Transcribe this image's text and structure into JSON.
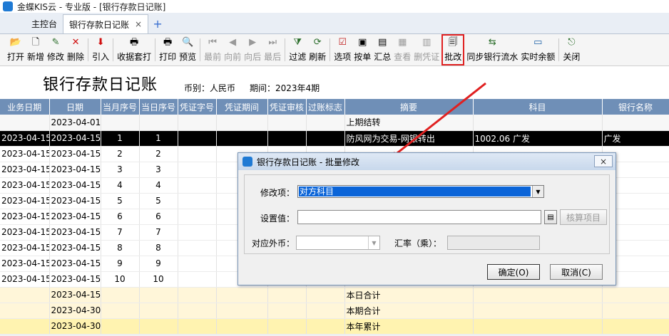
{
  "app": {
    "title": "金蝶KIS云 - 专业版 - [银行存款日记账]"
  },
  "tabs": [
    {
      "label": "主控台"
    },
    {
      "label": "银行存款日记账",
      "close": "×"
    }
  ],
  "tab_add": "+",
  "toolbar": {
    "open": "打开",
    "new": "新增",
    "edit": "修改",
    "delete": "删除",
    "import": "引入",
    "receipt_print": "收据套打",
    "print": "打印",
    "preview": "预览",
    "first": "最前",
    "prev": "向前",
    "next": "向后",
    "last": "最后",
    "filter": "过滤",
    "refresh": "刷新",
    "options": "选项",
    "by_voucher": "按单",
    "summary": "汇总",
    "view": "查看",
    "del_voucher": "删凭证",
    "batch_edit": "批改",
    "sync_bank": "同步银行流水",
    "realtime_balance": "实时余额",
    "close": "关闭"
  },
  "report": {
    "title": "银行存款日记账",
    "currency": "币别：人民币",
    "period": "期间：2023年4期"
  },
  "table": {
    "headers": [
      "业务日期",
      "日期",
      "当月序号",
      "当日序号",
      "凭证字号",
      "凭证期间",
      "凭证审核",
      "过账标志",
      "摘要",
      "科目",
      "银行名称"
    ],
    "rows": [
      {
        "biz": "",
        "date": "2023-04-01",
        "m": "",
        "d": "",
        "summary": "上期结转",
        "account": "",
        "bank": "",
        "kind": "carry"
      },
      {
        "biz": "2023-04-15",
        "date": "2023-04-15",
        "m": "1",
        "d": "1",
        "summary": "防风网为交易-网银转出",
        "account": "1002.06 广发",
        "bank": "广发",
        "kind": "selected"
      },
      {
        "biz": "2023-04-15",
        "date": "2023-04-15",
        "m": "2",
        "d": "2",
        "summary": "",
        "account": "",
        "bank": "",
        "kind": "normal"
      },
      {
        "biz": "2023-04-15",
        "date": "2023-04-15",
        "m": "3",
        "d": "3",
        "summary": "",
        "account": "",
        "bank": "",
        "kind": "normal"
      },
      {
        "biz": "2023-04-15",
        "date": "2023-04-15",
        "m": "4",
        "d": "4",
        "summary": "",
        "account": "",
        "bank": "",
        "kind": "normal"
      },
      {
        "biz": "2023-04-15",
        "date": "2023-04-15",
        "m": "5",
        "d": "5",
        "summary": "",
        "account": "",
        "bank": "",
        "kind": "normal"
      },
      {
        "biz": "2023-04-15",
        "date": "2023-04-15",
        "m": "6",
        "d": "6",
        "summary": "",
        "account": "",
        "bank": "",
        "kind": "normal"
      },
      {
        "biz": "2023-04-15",
        "date": "2023-04-15",
        "m": "7",
        "d": "7",
        "summary": "",
        "account": "",
        "bank": "",
        "kind": "normal"
      },
      {
        "biz": "2023-04-15",
        "date": "2023-04-15",
        "m": "8",
        "d": "8",
        "summary": "",
        "account": "",
        "bank": "",
        "kind": "normal"
      },
      {
        "biz": "2023-04-15",
        "date": "2023-04-15",
        "m": "9",
        "d": "9",
        "summary": "",
        "account": "",
        "bank": "",
        "kind": "normal"
      },
      {
        "biz": "2023-04-15",
        "date": "2023-04-15",
        "m": "10",
        "d": "10",
        "summary": "",
        "account": "",
        "bank": "",
        "kind": "normal"
      },
      {
        "biz": "",
        "date": "2023-04-15",
        "m": "",
        "d": "",
        "summary": "本日合计",
        "account": "",
        "bank": "",
        "kind": "subtotal"
      },
      {
        "biz": "",
        "date": "2023-04-30",
        "m": "",
        "d": "",
        "summary": "本期合计",
        "account": "",
        "bank": "",
        "kind": "subtotal"
      },
      {
        "biz": "",
        "date": "2023-04-30",
        "m": "",
        "d": "",
        "summary": "本年累计",
        "account": "",
        "bank": "",
        "kind": "total"
      }
    ]
  },
  "dialog": {
    "title": "银行存款日记账 - 批量修改",
    "close": "×",
    "field_label": "修改项：",
    "field_value": "对方科目",
    "setting_label": "设置值：",
    "setting_value": "",
    "calc_button": "核算项目",
    "currency_label": "对应外币：",
    "rate_label": "汇率（乘）：",
    "ok": "确定(O)",
    "cancel": "取消(C)"
  },
  "colors": {
    "header_bg": "#6f8fb7",
    "highlight": "#e02020",
    "selected_bg": "#000000"
  }
}
